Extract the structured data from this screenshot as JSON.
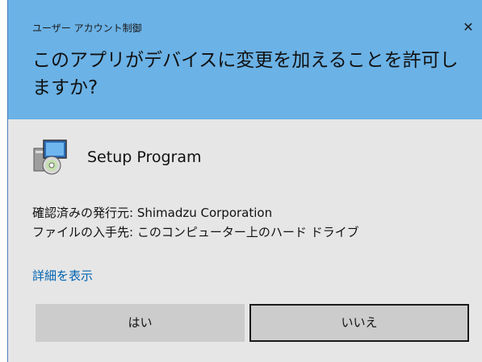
{
  "window": {
    "title": "ユーザー アカウント制御",
    "close_glyph": "✕"
  },
  "header": {
    "question": "このアプリがデバイスに変更を加えることを許可しますか?"
  },
  "app": {
    "name": "Setup Program",
    "icon": "setup-program-icon"
  },
  "details": {
    "publisher": "確認済みの発行元: Shimadzu Corporation",
    "origin": "ファイルの入手先: このコンピューター上のハード ドライブ"
  },
  "more_details_link": "詳細を表示",
  "buttons": {
    "yes": "はい",
    "no": "いいえ"
  },
  "colors": {
    "header_bg": "#6bb2e6",
    "body_bg": "#e6e6e6",
    "link": "#0063b1",
    "button_bg": "#cccccc"
  }
}
